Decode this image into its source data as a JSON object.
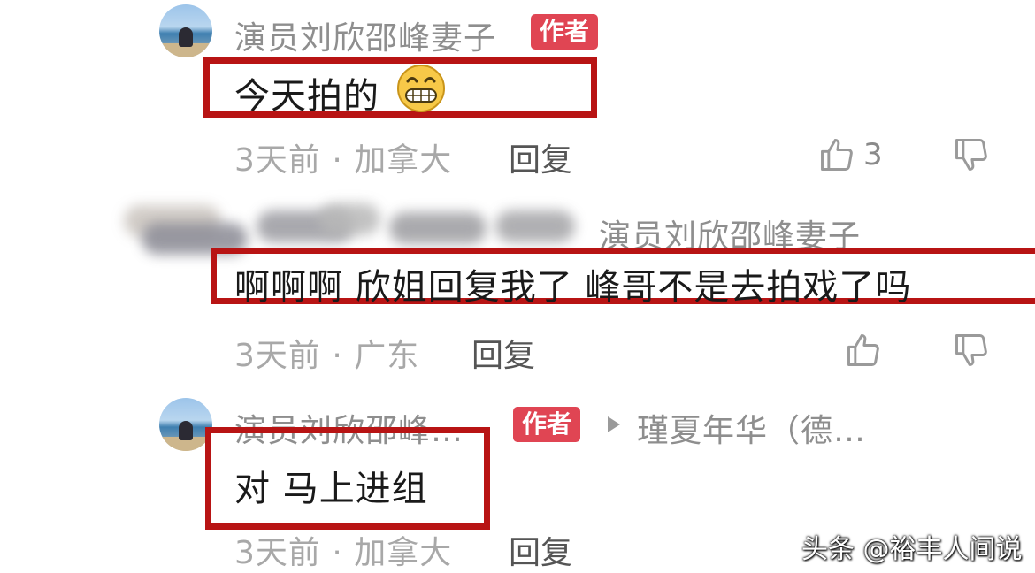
{
  "comments": [
    {
      "author": "演员刘欣邵峰妻子",
      "badge": "作者",
      "text": "今天拍的",
      "emoji": "grinning-face",
      "time_location": "3天前 · 加拿大",
      "reply_label": "回复",
      "like_count": "3"
    },
    {
      "reply_to": "演员刘欣邵峰妻子",
      "text": "啊啊啊 欣姐回复我了 峰哥不是去拍戏了吗",
      "time_location": "3天前 · 广东",
      "reply_label": "回复"
    },
    {
      "author": "演员刘欣邵峰…",
      "badge": "作者",
      "reply_target": "瑾夏年华（德…",
      "text": "对 马上进组",
      "time_location": "3天前 · 加拿大",
      "reply_label": "回复"
    }
  ],
  "watermark": "头条 @裕丰人间说",
  "colors": {
    "highlight_box": "#b81414",
    "author_badge": "#e04553"
  },
  "icons": [
    "thumbs-up-icon",
    "thumbs-down-icon",
    "play-arrow-icon"
  ]
}
